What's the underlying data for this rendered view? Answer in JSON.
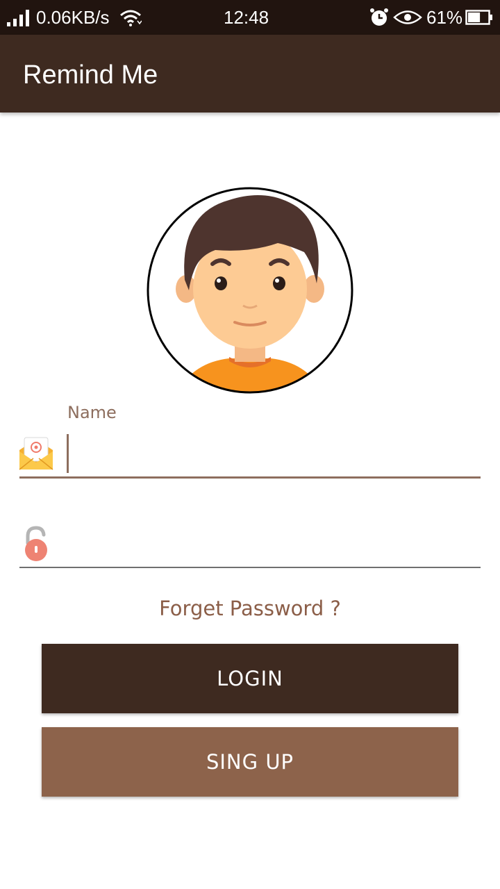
{
  "status_bar": {
    "net_speed": "0.06KB/s",
    "time": "12:48",
    "battery_percent": "61%",
    "battery_level": 0.61,
    "icons": [
      "signal-icon",
      "wifi-icon",
      "alarm-icon",
      "eye-icon",
      "battery-icon"
    ]
  },
  "app_bar": {
    "title": "Remind Me"
  },
  "form": {
    "name_label": "Name",
    "name_value": "",
    "password_value": "",
    "forget_password": "Forget Password ?",
    "login_label": "LOGIN",
    "signup_label": "SING UP"
  },
  "colors": {
    "status_bar": "#21140f",
    "primary": "#3e2a20",
    "accent": "#8d634b",
    "label": "#8d6e5e",
    "link": "#8b5e48"
  }
}
